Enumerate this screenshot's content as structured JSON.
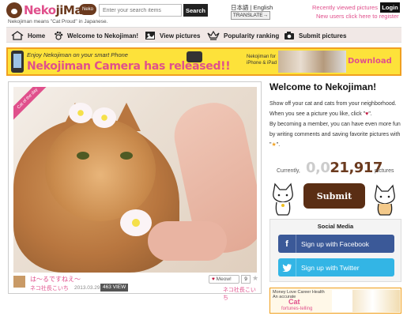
{
  "header": {
    "logo_pink": "Neko",
    "logo_brown": "jiMan",
    "logo_badge": "Neko CAT",
    "tagline": "Nekojiman means \"Cat Proud\" in Japanese.",
    "search": {
      "placeholder": "Enter your search items",
      "button": "Search"
    },
    "lang": {
      "japanese": "日本語",
      "separator": "|",
      "english": "English",
      "translate": "TRANSLATE→"
    },
    "recent_viewed": "Recently viewed pictures",
    "login": "Login",
    "register": "New users click here to register"
  },
  "nav": {
    "items": [
      {
        "label": "Home",
        "icon": "home-icon"
      },
      {
        "label": "Welcome to Nekojiman!",
        "icon": "paw-icon"
      },
      {
        "label": "View pictures",
        "icon": "pictures-icon"
      },
      {
        "label": "Popularity ranking",
        "icon": "crown-icon"
      },
      {
        "label": "Submit pictures",
        "icon": "camera-icon"
      }
    ]
  },
  "banner": {
    "sub": "Enjoy Nekojiman on your smart Phone",
    "title": "Nekojiman Camera has released!!",
    "for_line1": "Nekojiman for",
    "for_line2": "iPhone & iPad users",
    "download": "Download"
  },
  "photo": {
    "ribbon": "Cat of the day",
    "title": "は～るですねえ～",
    "user": "ネコ社長こいち",
    "date": "2013.03.29",
    "views": "463 VIEW",
    "meow_label": "Meow!",
    "meow_count": "9",
    "owner": "ネコ社長こいち"
  },
  "welcome": {
    "title": "Welcome to Nekojiman!",
    "line1": "Show off your cat and cats from your neighborhood.",
    "line2_a": "When you see a picture you like, click \"",
    "line2_b": "\".",
    "line3_a": "By becoming a member, you can have even more fun by writing comments and saving favorite pictures with \"",
    "line3_b": "\".",
    "counter_label": "Currently,",
    "counter_faded": "0,0",
    "counter_value": "21,917",
    "counter_unit": "pictures",
    "submit": "Submit"
  },
  "social": {
    "title": "Social Media",
    "facebook": "Sign up with Facebook",
    "twitter": "Sign up with Twitter"
  },
  "fortune": {
    "top": "Money Love Career Health",
    "accurate": "An accurate",
    "cat": "Cat",
    "sub": "fortunes-telling"
  },
  "colors": {
    "accent": "#e0508c",
    "brand_brown": "#6b3a1e",
    "facebook": "#3b5998",
    "twitter": "#33b5e5",
    "banner_yellow": "#fde23a"
  }
}
